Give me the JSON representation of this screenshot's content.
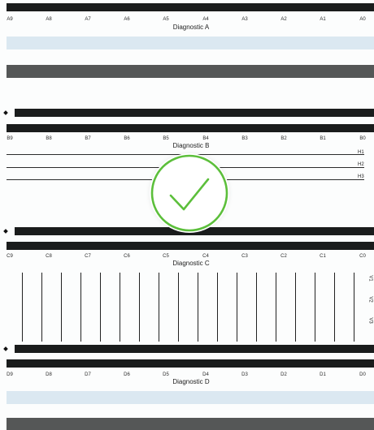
{
  "sections": [
    {
      "id": "A",
      "title": "Diagnostic A",
      "ticks": [
        "A9",
        "A8",
        "A7",
        "A6",
        "A5",
        "A4",
        "A3",
        "A2",
        "A1",
        "A0"
      ]
    },
    {
      "id": "B",
      "title": "Diagnostic B",
      "ticks": [
        "B9",
        "B8",
        "B7",
        "B6",
        "B5",
        "B4",
        "B3",
        "B2",
        "B1",
        "B0"
      ],
      "lines": [
        "H1",
        "H2",
        "H3"
      ]
    },
    {
      "id": "C",
      "title": "Diagnostic C",
      "ticks": [
        "C9",
        "C8",
        "C7",
        "C6",
        "C5",
        "C4",
        "C3",
        "C2",
        "C1",
        "C0"
      ],
      "lines": [
        "V1",
        "V2",
        "V3"
      ]
    },
    {
      "id": "D",
      "title": "Diagnostic D",
      "ticks": [
        "D9",
        "D8",
        "D7",
        "D6",
        "D5",
        "D4",
        "D3",
        "D2",
        "D1",
        "D0"
      ]
    }
  ],
  "status": {
    "icon": "check-icon",
    "color": "#5cbf3b"
  },
  "colors": {
    "dark_bar": "#1a1c1c",
    "gray_bar": "#555757",
    "light_bar": "#dbe8f1"
  }
}
